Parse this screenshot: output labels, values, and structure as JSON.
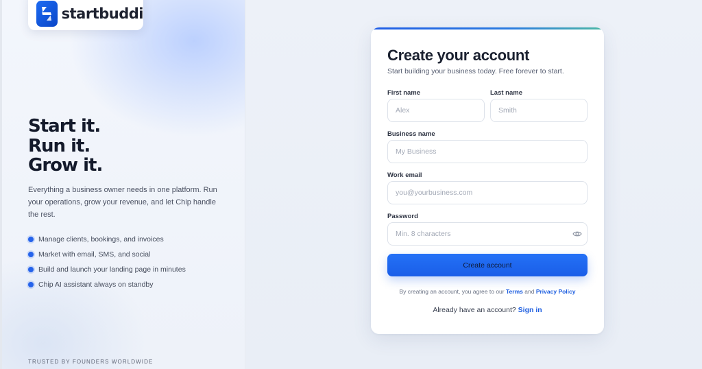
{
  "brand": {
    "name": "startbuddi",
    "logo_icon": "startbuddi-logo-icon"
  },
  "hero": {
    "headline": [
      "Start it.",
      "Run it.",
      "Grow it."
    ],
    "intro": "Everything a business owner needs in one platform. Run your operations, grow your revenue, and let Chip handle the rest.",
    "features": [
      "Manage clients, bookings, and invoices",
      "Market with email, SMS, and social",
      "Build and launch your landing page in minutes",
      "Chip AI assistant always on standby"
    ],
    "trusted": "TRUSTED BY FOUNDERS WORLDWIDE"
  },
  "form": {
    "title": "Create your account",
    "subtitle": "Start building your business today. Free forever to start.",
    "first_name": {
      "label": "First name",
      "placeholder": "Alex",
      "value": ""
    },
    "last_name": {
      "label": "Last name",
      "placeholder": "Smith",
      "value": ""
    },
    "business_name": {
      "label": "Business name",
      "placeholder": "My Business",
      "value": ""
    },
    "work_email": {
      "label": "Work email",
      "placeholder": "you@yourbusiness.com",
      "value": ""
    },
    "password": {
      "label": "Password",
      "placeholder": "Min. 8 characters",
      "value": "",
      "toggle_icon": "eye-icon"
    },
    "submit_label": "Create account",
    "terms_prefix": "By creating an account, you agree to our",
    "terms_link": "Terms",
    "terms_and": "and",
    "privacy_link": "Privacy Policy",
    "signin_prefix": "Already have an account?",
    "signin_link": "Sign in"
  },
  "colors": {
    "accent": "#1d5ee0",
    "button": "#1a5ee8",
    "headline": "#141a2b"
  }
}
